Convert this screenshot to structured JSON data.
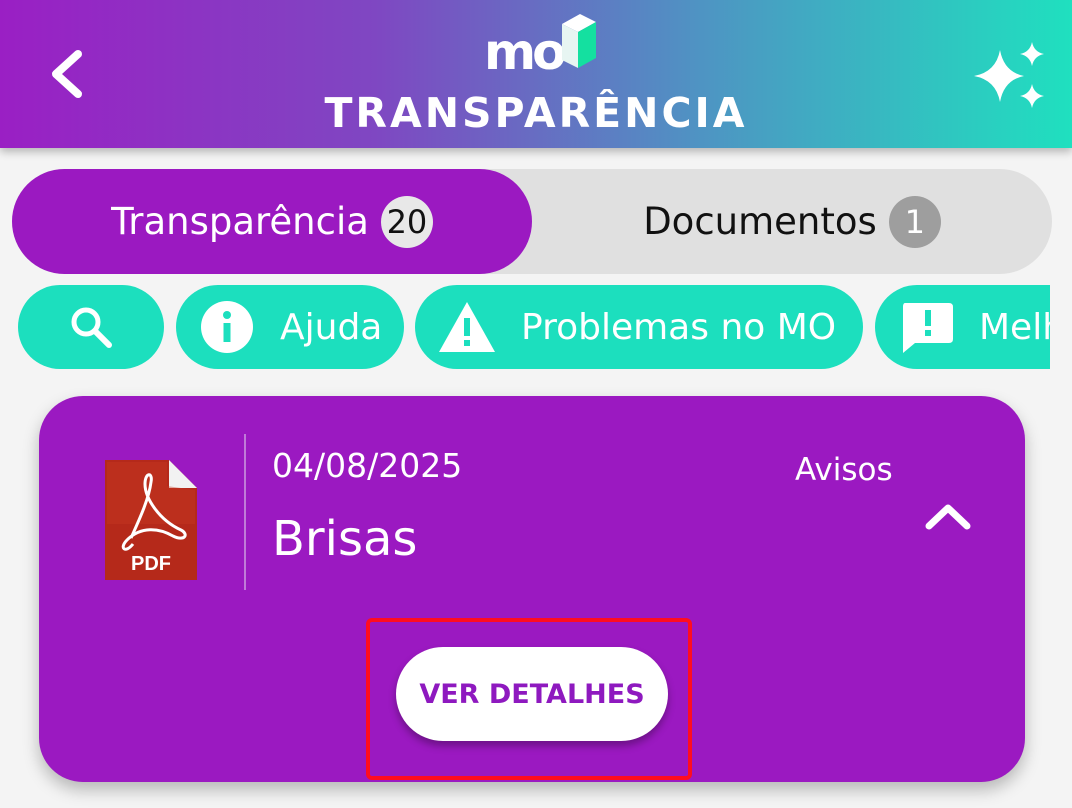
{
  "header": {
    "logo_text": "mo",
    "title": "TRANSPARÊNCIA",
    "back_icon": "chevron-left-icon",
    "action_icon": "sparkles-icon"
  },
  "tabs": [
    {
      "label": "Transparência",
      "count": "20",
      "active": true
    },
    {
      "label": "Documentos",
      "count": "1",
      "active": false
    }
  ],
  "chips": [
    {
      "icon": "search-icon",
      "label": ""
    },
    {
      "icon": "info-icon",
      "label": "Ajuda"
    },
    {
      "icon": "warning-icon",
      "label": "Problemas no MO"
    },
    {
      "icon": "feedback-icon",
      "label": "Melhorias"
    }
  ],
  "document": {
    "date": "04/08/2025",
    "title": "Brisas",
    "category": "Avisos",
    "file_type": "PDF",
    "details_label": "VER DETALHES",
    "collapse_icon": "chevron-up-icon"
  },
  "colors": {
    "primary": "#9b19c1",
    "accent": "#1cdfbe",
    "highlight": "#ff0d20"
  }
}
